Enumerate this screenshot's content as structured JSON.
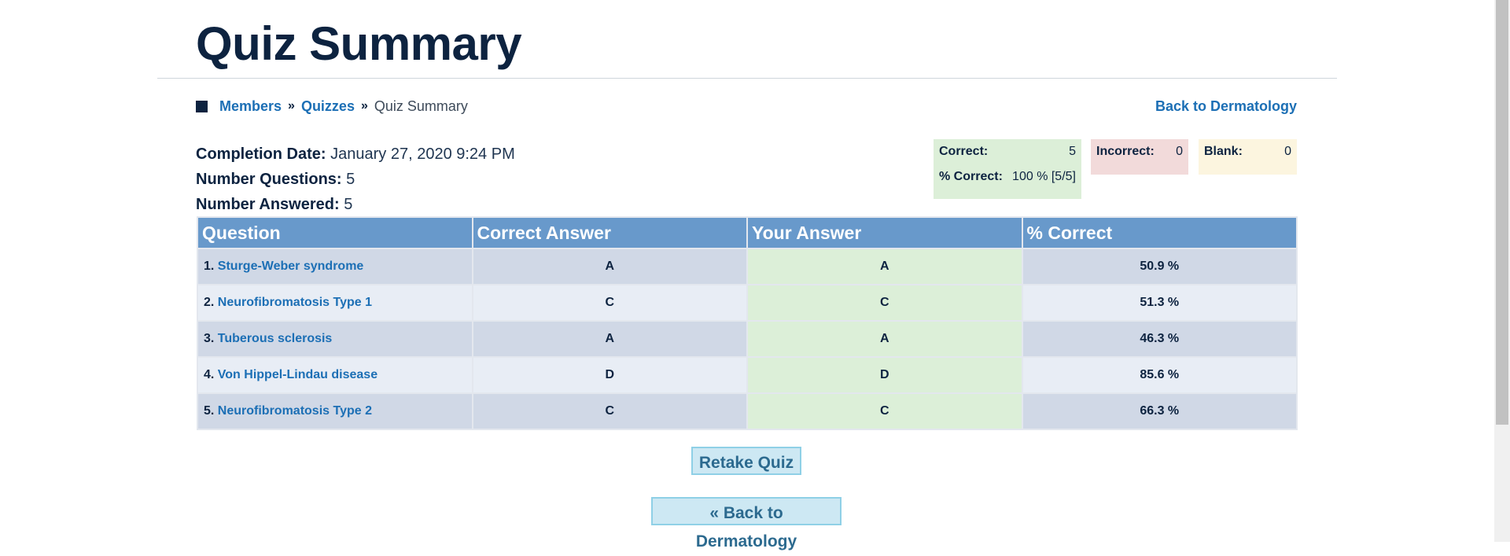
{
  "page_title": "Quiz Summary",
  "breadcrumb": {
    "items": [
      "Members",
      "Quizzes"
    ],
    "separator": "»",
    "current": "Quiz Summary"
  },
  "back_link": "Back to Dermatology",
  "meta": {
    "completion_label": "Completion Date:",
    "completion_value": "January 27, 2020 9:24 PM",
    "questions_label": "Number Questions:",
    "questions_value": "5",
    "answered_label": "Number Answered:",
    "answered_value": "5"
  },
  "stats": {
    "correct_label": "Correct:",
    "correct_value": "5",
    "pct_label": "% Correct:",
    "pct_value": "100 % [5/5]",
    "incorrect_label": "Incorrect:",
    "incorrect_value": "0",
    "blank_label": "Blank:",
    "blank_value": "0"
  },
  "table": {
    "headers": [
      "Question",
      "Correct Answer",
      "Your Answer",
      "% Correct"
    ],
    "rows": [
      {
        "num": "1.",
        "question": "Sturge-Weber syndrome",
        "correct": "A",
        "yours": "A",
        "pct": "50.9 %"
      },
      {
        "num": "2.",
        "question": "Neurofibromatosis Type 1",
        "correct": "C",
        "yours": "C",
        "pct": "51.3 %"
      },
      {
        "num": "3.",
        "question": "Tuberous sclerosis",
        "correct": "A",
        "yours": "A",
        "pct": "46.3 %"
      },
      {
        "num": "4.",
        "question": "Von Hippel-Lindau disease",
        "correct": "D",
        "yours": "D",
        "pct": "85.6 %"
      },
      {
        "num": "5.",
        "question": "Neurofibromatosis Type 2",
        "correct": "C",
        "yours": "C",
        "pct": "66.3 %"
      }
    ]
  },
  "buttons": {
    "retake": "Retake Quiz",
    "back": "« Back to Dermatology"
  },
  "colors": {
    "header_navy": "#0d2340",
    "link_blue": "#1c6fb5",
    "table_header": "#6899cb",
    "correct_green": "#dcefd8",
    "incorrect_red": "#f2dada",
    "blank_yellow": "#fcf5df"
  }
}
